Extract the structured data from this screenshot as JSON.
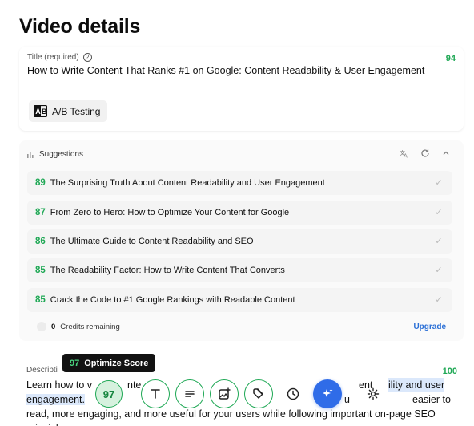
{
  "page": {
    "title": "Video details"
  },
  "title_field": {
    "label": "Title (required)",
    "help_icon": "question-circle-icon",
    "score": "94",
    "value": "How to Write Content That Ranks #1 on Google: Content Readability & User Engagement",
    "ab_button_label": "A/B Testing"
  },
  "suggestions": {
    "header": "Suggestions",
    "items": [
      {
        "score": "89",
        "text": "The Surprising Truth About Content Readability and User Engagement"
      },
      {
        "score": "87",
        "text": "From Zero to Hero: How to Optimize Your Content for Google"
      },
      {
        "score": "86",
        "text": "The Ultimate Guide to Content Readability and SEO"
      },
      {
        "score": "85",
        "text": "The Readability Factor: How to Write Content That Converts"
      },
      {
        "score": "85",
        "text": "Crack Ihe Code to #1 Google Rankings with Readable Content"
      }
    ],
    "credits_count": "0",
    "credits_text": "Credits remaining",
    "upgrade_label": "Upgrade"
  },
  "description_field": {
    "label": "Descripti",
    "score": "100",
    "line1_a": "Learn how to v",
    "line1_b": "nte",
    "line1_c": "ent",
    "line1_d": "ility and user",
    "line2_a": "engagement.",
    "line2_b": "ac",
    "line2_c": "u",
    "line2_d": "easier to",
    "line3": "read, more engaging, and more useful for your users while following important on-page SEO",
    "line4": "principles"
  },
  "tooltip": {
    "score": "97",
    "label": "Optimize Score"
  },
  "toolbar": {
    "score": "97"
  },
  "colors": {
    "accent_green": "#1fa855",
    "accent_blue": "#2f6ce8",
    "link_blue": "#2a6fd6"
  }
}
